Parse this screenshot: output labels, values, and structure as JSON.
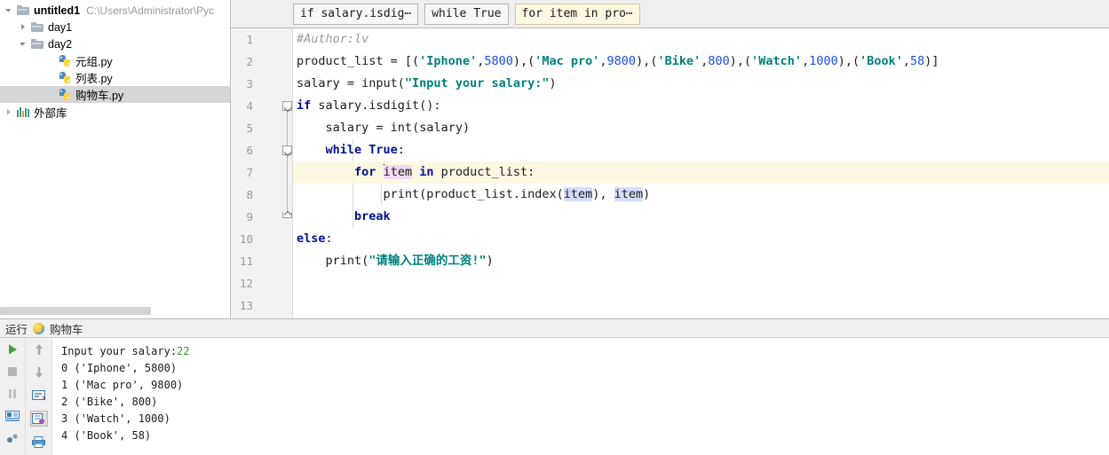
{
  "sidebar": {
    "tree": [
      {
        "label": "untitled1",
        "path": "C:\\Users\\Administrator\\Pyc",
        "icon": "folder-icon",
        "arrow": "down",
        "bold": true,
        "indent": 1,
        "selected": false
      },
      {
        "label": "day1",
        "path": "",
        "icon": "folder-icon",
        "arrow": "right",
        "bold": false,
        "indent": 2,
        "selected": false
      },
      {
        "label": "day2",
        "path": "",
        "icon": "folder-icon",
        "arrow": "down",
        "bold": false,
        "indent": 2,
        "selected": false
      },
      {
        "label": "元组.py",
        "path": "",
        "icon": "python-file-icon",
        "arrow": "none",
        "bold": false,
        "indent": 3,
        "selected": false
      },
      {
        "label": "列表.py",
        "path": "",
        "icon": "python-file-icon",
        "arrow": "none",
        "bold": false,
        "indent": 3,
        "selected": false
      },
      {
        "label": "购物车.py",
        "path": "",
        "icon": "python-file-icon",
        "arrow": "none",
        "bold": false,
        "indent": 3,
        "selected": true
      },
      {
        "label": "外部库",
        "path": "",
        "icon": "external-libraries-icon",
        "arrow": "right",
        "bold": false,
        "indent": 1,
        "selected": false
      }
    ]
  },
  "breadcrumbs": [
    {
      "label": "if salary.isdig⋯",
      "active": false
    },
    {
      "label": "while True",
      "active": false
    },
    {
      "label": "for item in pro⋯",
      "active": true
    }
  ],
  "editor": {
    "line_numbers": [
      "1",
      "2",
      "3",
      "4",
      "5",
      "6",
      "7",
      "8",
      "9",
      "10",
      "11",
      "12",
      "13"
    ],
    "current_line": 7,
    "lines": {
      "l1_comment": "#Author:lv",
      "l2_a": "product_list = [(",
      "l2_s1": "'Iphone'",
      "l2_b": ",",
      "l2_n1": "5800",
      "l2_c": "),(",
      "l2_s2": "'Mac pro'",
      "l2_d": ",",
      "l2_n2": "9800",
      "l2_e": "),(",
      "l2_s3": "'Bike'",
      "l2_f": ",",
      "l2_n3": "800",
      "l2_g": "),(",
      "l2_s4": "'Watch'",
      "l2_h": ",",
      "l2_n4": "1000",
      "l2_i": "),(",
      "l2_s5": "'Book'",
      "l2_j": ",",
      "l2_n5": "58",
      "l2_k": ")]",
      "l3_a": "salary = input(",
      "l3_s": "\"Input your salary:\"",
      "l3_b": ")",
      "l4_kw": "if",
      "l4_rest": " salary.isdigit():",
      "l5": "    salary = ",
      "l5_fn": "int",
      "l5_rest": "(salary)",
      "l6_kw": "while True",
      "l6_rest": ":",
      "l7_kw1": "for",
      "l7_var": "item",
      "l7_kw2": "in",
      "l7_rest": " product_list:",
      "l8_a": "            print(product_list.index(",
      "l8_v1": "item",
      "l8_b": "), ",
      "l8_v2": "item",
      "l8_c": ")",
      "l9_kw": "break",
      "l10_kw": "else",
      "l10_rest": ":",
      "l11_a": "    print(",
      "l11_s": "\"请输入正确的工资!\"",
      "l11_b": ")"
    }
  },
  "run_panel": {
    "title": "运行",
    "tab_label": "购物车",
    "console": [
      {
        "text": "Input your salary:",
        "input": "22"
      },
      {
        "text": "0 ('Iphone', 5800)",
        "input": ""
      },
      {
        "text": "1 ('Mac pro', 9800)",
        "input": ""
      },
      {
        "text": "2 ('Bike', 800)",
        "input": ""
      },
      {
        "text": "3 ('Watch', 1000)",
        "input": ""
      },
      {
        "text": "4 ('Book', 58)",
        "input": ""
      }
    ]
  },
  "colors": {
    "string": "#008080",
    "keyword": "#00128c",
    "number": "#1750eb",
    "comment": "#9b9b9b",
    "current_line": "#fdf8e2",
    "selection": "#d6d6d6",
    "occurrence_write": "#f2d9f2",
    "occurrence_read": "#d6dcfb"
  }
}
